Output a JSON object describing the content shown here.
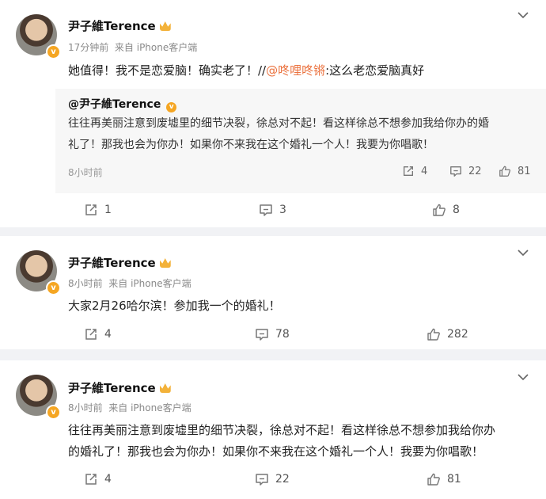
{
  "user": {
    "name": "尹子維Terence"
  },
  "posts": [
    {
      "time": "17分钟前",
      "source": "来自 iPhone客户端",
      "text_before": "她值得！我不是恋爱脑！确实老了！//",
      "mention": "@咚哩咚锵",
      "text_after": ":这么老恋爱脑真好",
      "quote": {
        "name": "@尹子維Terence",
        "line1": "往往再美丽注意到废墟里的细节决裂，徐总对不起！看这样徐总不想参加我给你办的婚",
        "line2": "礼了！那我也会为你办！如果你不来我在这个婚礼一个人！我要为你唱歌！",
        "time": "8小时前",
        "reposts": "4",
        "comments": "22",
        "likes": "81"
      },
      "reposts": "1",
      "comments": "3",
      "likes": "8"
    },
    {
      "time": "8小时前",
      "source": "来自 iPhone客户端",
      "text": "大家2月26哈尔滨！参加我一个的婚礼！",
      "reposts": "4",
      "comments": "78",
      "likes": "282"
    },
    {
      "time": "8小时前",
      "source": "来自 iPhone客户端",
      "line1": "往往再美丽注意到废墟里的细节决裂，徐总对不起！看这样徐总不想参加我给你办",
      "line2": "的婚礼了！那我也会为你办！如果你不来我在这个婚礼一个人！我要为你唱歌！",
      "reposts": "4",
      "comments": "22",
      "likes": "81"
    }
  ],
  "icons": {
    "repost": "repost-icon",
    "comment": "comment-icon",
    "like": "like-icon",
    "more": "chevron-down-icon",
    "verified": "verified-badge-icon",
    "vip": "crown-icon"
  },
  "colors": {
    "mention": "#eb7340",
    "verified": "#f5a623",
    "vip": "#f3b23a",
    "background": "#f1f2f5"
  }
}
